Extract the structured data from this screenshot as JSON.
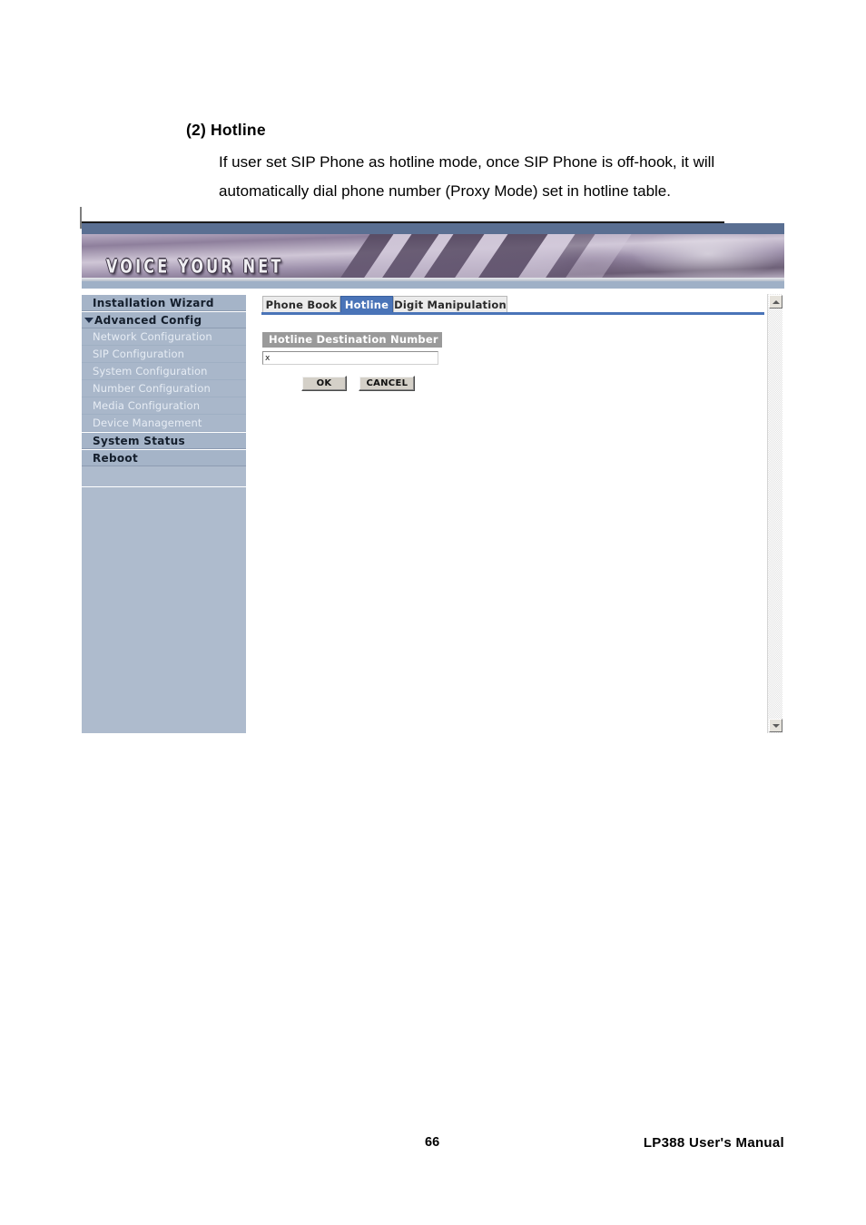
{
  "document": {
    "section_heading": "(2) Hotline",
    "body_text": "If user set SIP Phone as hotline mode, once SIP Phone is off-hook, it will automatically dial phone number (Proxy Mode) set in hotline table.",
    "footer_page_number": "66",
    "footer_manual_title": "LP388  User's  Manual"
  },
  "app": {
    "banner": {
      "logo_text": "VOICE YOUR NET"
    },
    "sidebar": {
      "items": [
        {
          "label": "Installation Wizard",
          "level": "top",
          "expanded": false
        },
        {
          "label": "Advanced Config",
          "level": "top",
          "expanded": true
        },
        {
          "label": "Network Configuration",
          "level": "sub"
        },
        {
          "label": "SIP Configuration",
          "level": "sub"
        },
        {
          "label": "System Configuration",
          "level": "sub"
        },
        {
          "label": "Number Configuration",
          "level": "sub"
        },
        {
          "label": "Media Configuration",
          "level": "sub"
        },
        {
          "label": "Device Management",
          "level": "sub"
        },
        {
          "label": "System Status",
          "level": "top",
          "expanded": false
        },
        {
          "label": "Reboot",
          "level": "top",
          "expanded": false
        }
      ]
    },
    "tabs": [
      {
        "label": "Phone Book",
        "active": false
      },
      {
        "label": "Hotline",
        "active": true
      },
      {
        "label": "Digit Manipulation",
        "active": false
      }
    ],
    "form": {
      "section_title": "Hotline Destination Number",
      "destination_value": "x",
      "destination_placeholder": "",
      "ok_label": "OK",
      "cancel_label": "CANCEL"
    },
    "colors": {
      "accent_blue": "#4a74b8",
      "sidebar_blue": "#aebbcd",
      "banner_strip": "#5a6f92",
      "section_gray": "#9a9a9a"
    }
  }
}
